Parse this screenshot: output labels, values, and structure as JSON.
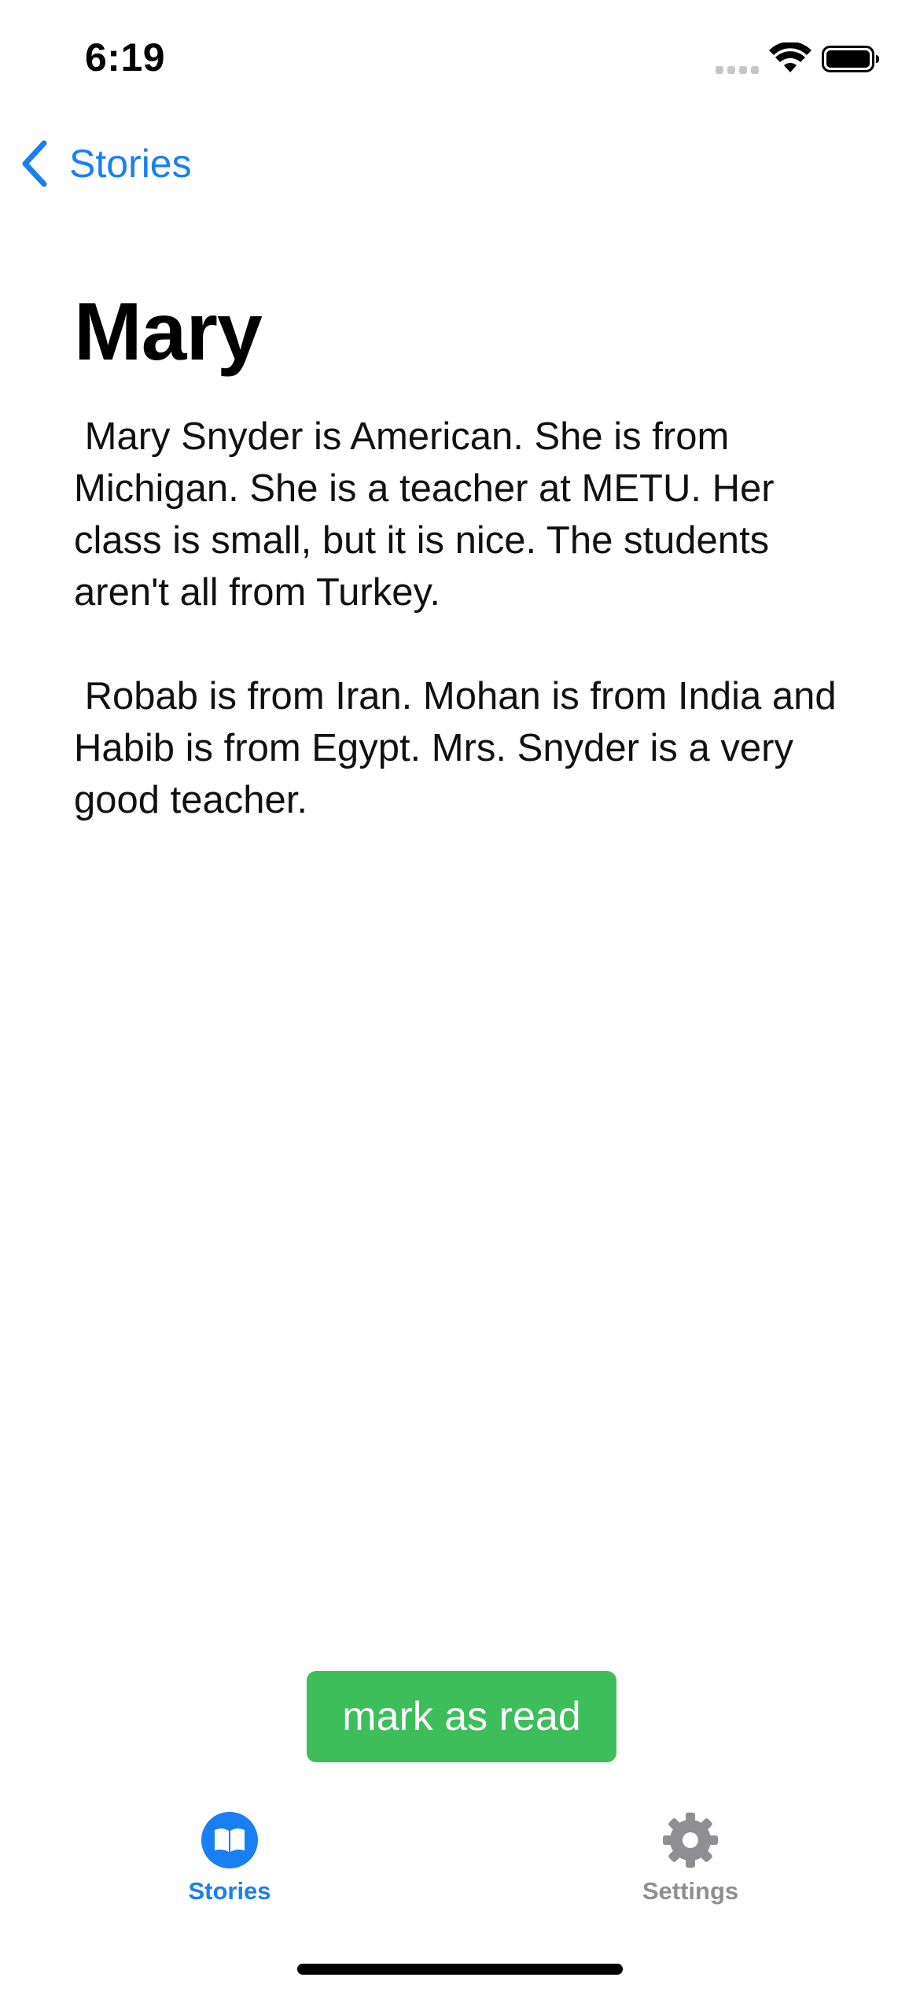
{
  "status_bar": {
    "time": "6:19"
  },
  "nav": {
    "back_label": "Stories",
    "back_icon": "chevron-left-icon"
  },
  "story": {
    "title": "Mary",
    "body": " Mary Snyder is American. She is from Michigan. She is a teacher at METU. Her class is small, but it is nice. The students aren't all from Turkey.\n\n Robab is from Iran. Mohan is from India and Habib is from Egypt. Mrs. Snyder is a very good teacher."
  },
  "actions": {
    "mark_read_label": "mark as read"
  },
  "tab_bar": {
    "tabs": [
      {
        "label": "Stories",
        "icon": "book-icon",
        "selected": true
      },
      {
        "label": "Settings",
        "icon": "gear-icon",
        "selected": false
      }
    ]
  },
  "colors": {
    "accent": "#1a7ff0",
    "button_green": "#3dbe5b",
    "inactive_gray": "#8e8e93"
  }
}
